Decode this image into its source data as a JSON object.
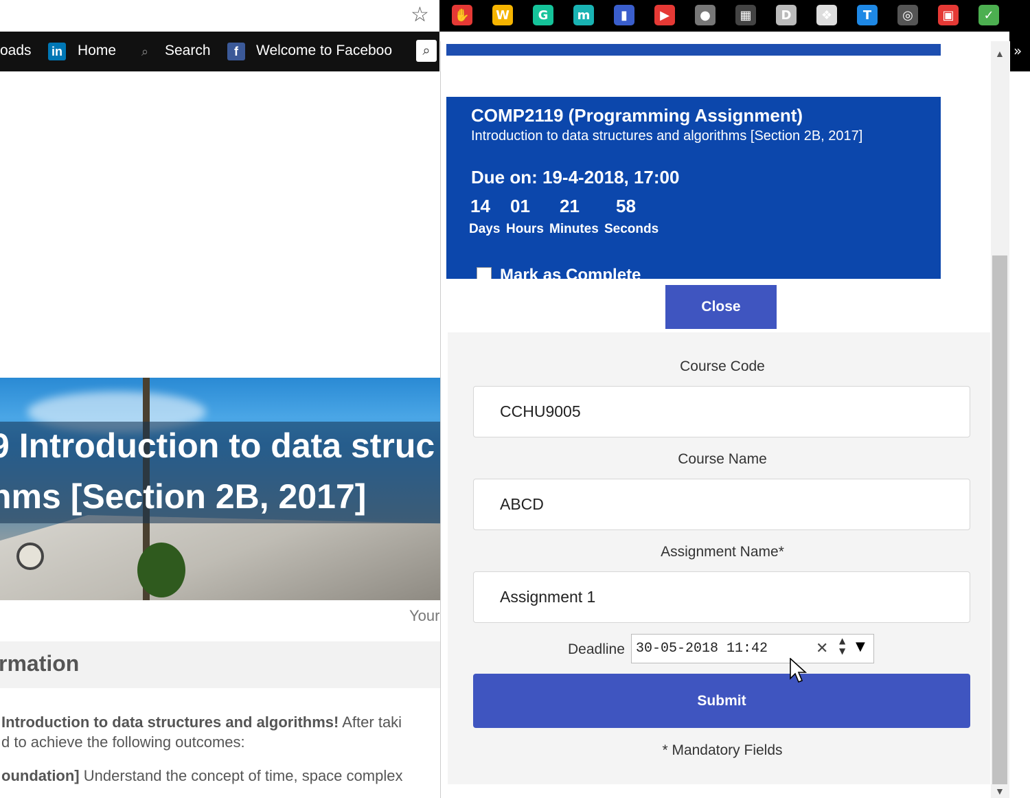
{
  "browser": {
    "bookmarks": [
      {
        "label": "oads"
      },
      {
        "label": "Home",
        "icon": "linkedin-icon",
        "icon_text": "in",
        "icon_color": "#0077b5"
      },
      {
        "label": "Search",
        "icon": "search-icon"
      },
      {
        "label": "Welcome to Faceboo",
        "icon": "facebook-icon",
        "icon_text": "f",
        "icon_color": "#3b5998"
      }
    ],
    "overflow_label": "»",
    "extensions": [
      {
        "name": "adblock-icon",
        "color": "#e53935",
        "glyph": "✋"
      },
      {
        "name": "wikiwand-icon",
        "color": "#f5b400",
        "glyph": "W"
      },
      {
        "name": "grammarly-icon",
        "color": "#15c39a",
        "glyph": "G"
      },
      {
        "name": "mercury-icon",
        "color": "#19b3b3",
        "glyph": "m"
      },
      {
        "name": "bookmark-icon",
        "color": "#3a5ecc",
        "glyph": "▮"
      },
      {
        "name": "video-icon",
        "color": "#e53935",
        "glyph": "▶"
      },
      {
        "name": "ghost-icon",
        "color": "#777777",
        "glyph": "●"
      },
      {
        "name": "film-icon",
        "color": "#444444",
        "glyph": "▦"
      },
      {
        "name": "d-icon",
        "color": "#bbbbbb",
        "glyph": "D"
      },
      {
        "name": "paper-icon",
        "color": "#dddddd",
        "glyph": "❖"
      },
      {
        "name": "t-icon",
        "color": "#1e88e5",
        "glyph": "T"
      },
      {
        "name": "swirl-icon",
        "color": "#555555",
        "glyph": "◎"
      },
      {
        "name": "calendar-icon",
        "color": "#e53935",
        "glyph": "▣"
      },
      {
        "name": "checklist-icon",
        "color": "#4caf50",
        "glyph": "✓"
      }
    ]
  },
  "background_page": {
    "banner_line1": "9 Introduction to data struc",
    "banner_line2": "hms [Section 2B, 2017]",
    "your_text": "Your",
    "info_heading": "rmation",
    "line1_bold": "Introduction to data structures and algorithms!",
    "line1_rest": " After taki",
    "line2": "d to achieve the following outcomes:",
    "line3_bold": "oundation]",
    "line3_rest": " Understand the concept of time, space complex"
  },
  "popup": {
    "card": {
      "title": "COMP2119 (Programming Assignment)",
      "subtitle": "Introduction to data structures and algorithms [Section 2B, 2017]",
      "due": "Due on: 19-4-2018, 17:00",
      "countdown": [
        {
          "value": "14",
          "unit": "Days"
        },
        {
          "value": "01",
          "unit": "Hours"
        },
        {
          "value": "21",
          "unit": "Minutes"
        },
        {
          "value": "58",
          "unit": "Seconds"
        }
      ],
      "mark_complete": "Mark as Complete"
    },
    "close_label": "Close",
    "form": {
      "course_code_label": "Course Code",
      "course_code_value": "CCHU9005",
      "course_name_label": "Course Name",
      "course_name_value": "ABCD",
      "assignment_name_label": "Assignment Name*",
      "assignment_name_value": "Assignment 1",
      "deadline_label": "Deadline",
      "deadline_value": "30-05-2018 11:42",
      "submit_label": "Submit",
      "mandatory_note": "* Mandatory Fields"
    }
  }
}
